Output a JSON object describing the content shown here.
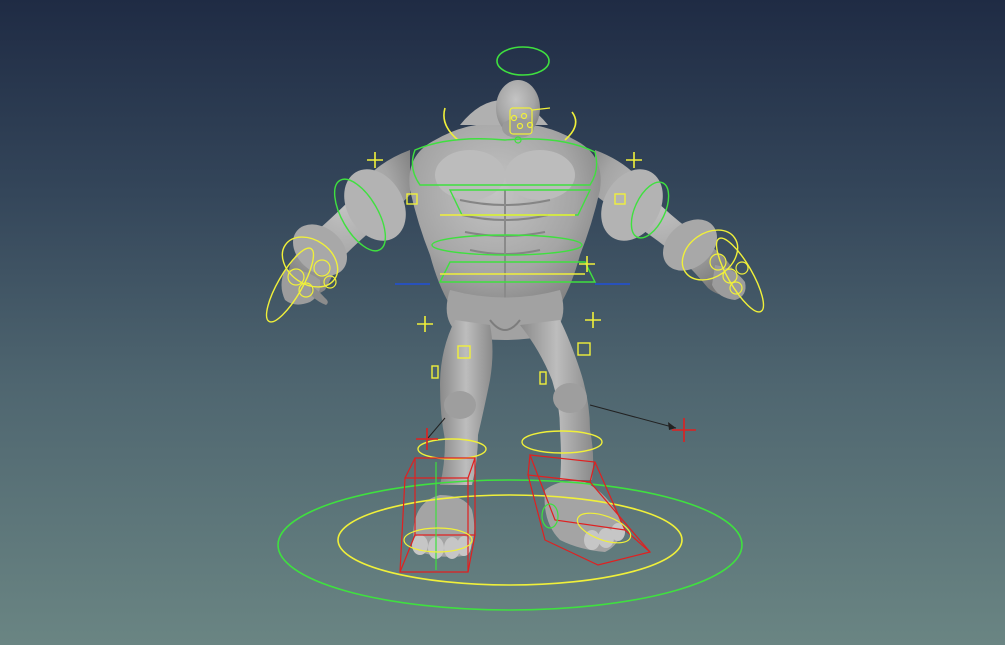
{
  "viewport": {
    "name": "3D viewport",
    "background_top": "#1f2b44",
    "background_bottom": "#6a8583"
  },
  "character": {
    "mesh_color": "#a9a9a9",
    "mesh_shadow": "#7b7b7b"
  },
  "rig": {
    "primary_control_color": "#3fe03f",
    "secondary_control_color": "#f0f03a",
    "ik_handle_color": "#e02020",
    "pole_vector_color": "#222222",
    "axis_blue": "#2050d8"
  }
}
